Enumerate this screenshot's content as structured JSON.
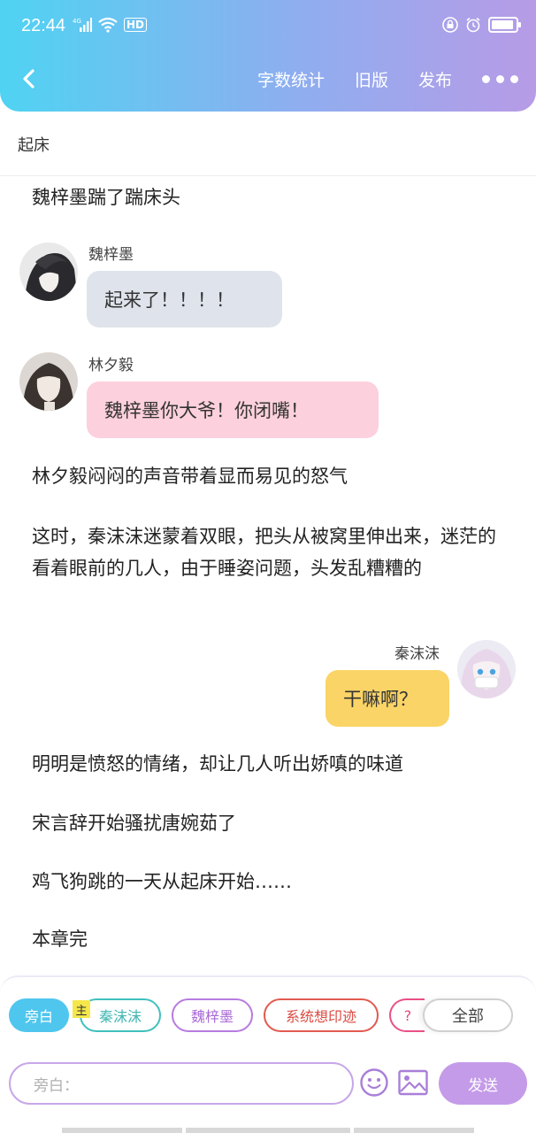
{
  "status_bar": {
    "time": "22:44",
    "network": "4G",
    "hd": "HD"
  },
  "header": {
    "actions": [
      "字数统计",
      "旧版",
      "发布"
    ]
  },
  "chapter": {
    "title": "起床"
  },
  "story": {
    "narration_1": "魏梓墨踹了踹床头",
    "msg1": {
      "speaker": "魏梓墨",
      "text": "起来了！！！！"
    },
    "msg2": {
      "speaker": "林夕毅",
      "text": "魏梓墨你大爷！你闭嘴！"
    },
    "narration_2": "林夕毅闷闷的声音带着显而易见的怒气",
    "narration_3": "这时，秦沫沫迷蒙着双眼，把头从被窝里伸出来，迷茫的看着眼前的几人，由于睡姿问题，头发乱糟糟的",
    "msg3": {
      "speaker": "秦沫沫",
      "text": "干嘛啊？"
    },
    "narration_4": "明明是愤怒的情绪，却让几人听出娇嗔的味道",
    "narration_5": "宋言辞开始骚扰唐婉茹了",
    "narration_6": "鸡飞狗跳的一天从起床开始……",
    "narration_7": "本章完"
  },
  "roles": {
    "chips": [
      "旁白",
      "秦沫沫",
      "魏梓墨",
      "系统想印迹",
      "?",
      "全部"
    ],
    "main_tag": "主"
  },
  "composer": {
    "placeholder": "旁白：",
    "send_label": "发送"
  },
  "colors": {
    "header_start": "#4fd3f2",
    "header_end": "#b79be6",
    "bubble_wei": "#dfe4ec",
    "bubble_lin": "#fcd0dd",
    "bubble_qin": "#fad466",
    "accent": "#c49be8"
  },
  "icons": [
    "back-arrow-icon",
    "more-dots-icon",
    "emoji-icon",
    "image-icon",
    "signal-icon",
    "wifi-icon",
    "alarm-icon",
    "lock-icon",
    "battery-icon"
  ]
}
